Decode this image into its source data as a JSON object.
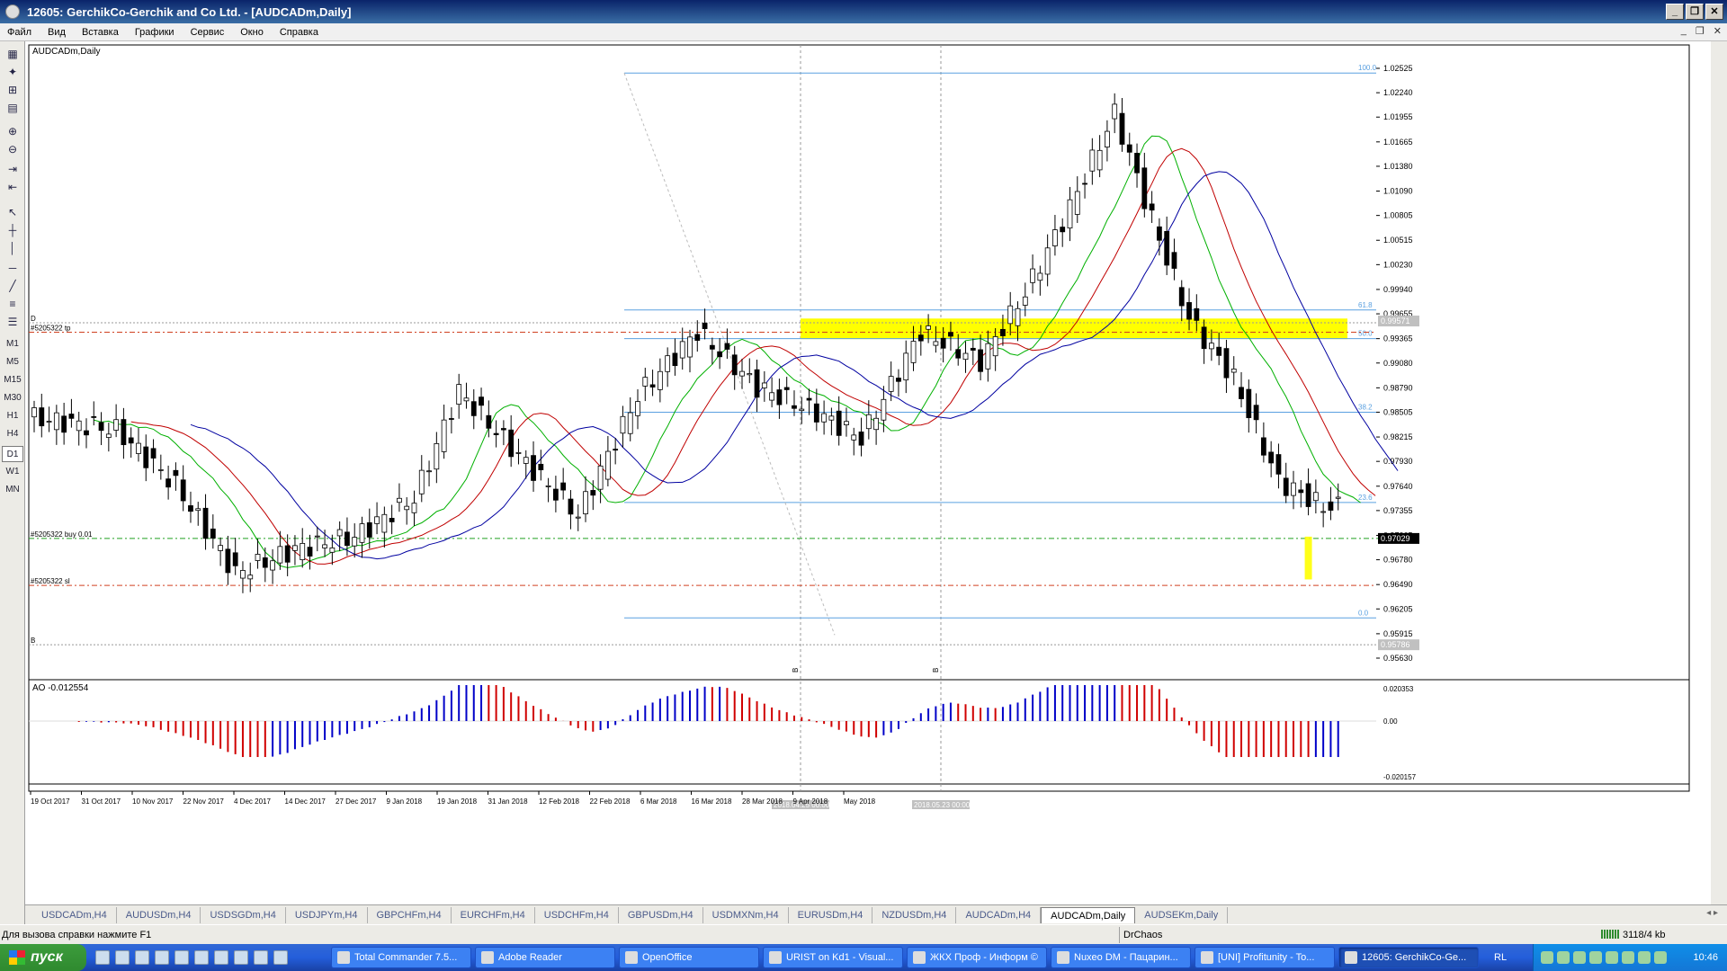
{
  "window": {
    "title": "12605: GerchikCo-Gerchik and Co Ltd. - [AUDCADm,Daily]",
    "controls": [
      "_",
      "❐",
      "✕"
    ]
  },
  "menu": {
    "items": [
      "Файл",
      "Вид",
      "Вставка",
      "Графики",
      "Сервис",
      "Окно",
      "Справка"
    ],
    "mdi_controls": [
      "_",
      "❐",
      "✕"
    ]
  },
  "timeframes": [
    "M1",
    "M5",
    "M15",
    "M30",
    "H1",
    "H4",
    "D1",
    "W1",
    "MN"
  ],
  "active_timeframe": "D1",
  "chart": {
    "symbol_label": "AUDCADm,Daily",
    "orders": {
      "tp": "#5205322 tp",
      "buy": "#5205322 buy 0.01",
      "sl": "#5205322 sl",
      "d_marker": "D",
      "b_marker": "B"
    },
    "price_levels": [
      "1.02525",
      "1.02240",
      "1.01955",
      "1.01665",
      "1.01380",
      "1.01090",
      "1.00805",
      "1.00515",
      "1.00230",
      "0.99940",
      "0.99655",
      "0.99365",
      "0.99080",
      "0.98790",
      "0.98505",
      "0.98215",
      "0.97930",
      "0.97640",
      "0.97355",
      "0.97065",
      "0.96780",
      "0.96490",
      "0.96205",
      "0.95915",
      "0.95630"
    ],
    "current_price": "0.97029",
    "tp_price": "0.99571",
    "b_price": "0.95786",
    "fib_labels": [
      "100.0",
      "61.8",
      "50.0",
      "38.2",
      "23.6",
      "0.0"
    ],
    "date_labels": [
      "19 Oct 2017",
      "31 Oct 2017",
      "10 Nov 2017",
      "22 Nov 2017",
      "4 Dec 2017",
      "14 Dec 2017",
      "27 Dec 2017",
      "9 Jan 2018",
      "19 Jan 2018",
      "31 Jan 2018",
      "12 Feb 2018",
      "22 Feb 2018",
      "6 Mar 2018",
      "16 Mar 2018",
      "28 Mar 2018",
      "9 Apr 2018",
      "May 2018"
    ],
    "crosshair_dates": [
      "2018.04.25 00:00",
      "2018.05.23 00:00"
    ],
    "vline_marker": "B",
    "colors": {
      "bull_candle": "#ffffff",
      "bear_candle": "#000000",
      "ma_fast": "#00b000",
      "ma_mid": "#c00000",
      "ma_slow": "#0000a0",
      "fib": "#5aa0e0",
      "order_line": "#d04020",
      "buy_line": "#20a020",
      "zone": "#ffff00"
    }
  },
  "ao": {
    "label": "AO -0.012554",
    "levels": [
      "0.020353",
      "0.00",
      "-0.020157"
    ],
    "up_color": "#0000c8",
    "down_color": "#d00000"
  },
  "tabs": [
    "USDCADm,H4",
    "AUDUSDm,H4",
    "USDSGDm,H4",
    "USDJPYm,H4",
    "GBPCHFm,H4",
    "EURCHFm,H4",
    "USDCHFm,H4",
    "GBPUSDm,H4",
    "USDMXNm,H4",
    "EURUSDm,H4",
    "NZDUSDm,H4",
    "AUDCADm,H4",
    "AUDCADm,Daily",
    "AUDSEKm,Daily"
  ],
  "active_tab": "AUDCADm,Daily",
  "status": {
    "help": "Для вызова справки нажмите F1",
    "profile": "DrChaos",
    "traffic": "3118/4 kb"
  },
  "taskbar": {
    "start": "пуск",
    "tasks": [
      "Total Commander 7.5...",
      "Adobe Reader",
      "OpenOffice",
      "URIST on Kd1 - Visual...",
      "ЖКХ Проф - Информ ©",
      "Nuxeo DM - Пацарин...",
      "[UNI] Profitunity - To...",
      "12605: GerchikCo-Ge..."
    ],
    "active_task": "12605: GerchikCo-Ge...",
    "lang": "RL",
    "clock": "10:46"
  }
}
